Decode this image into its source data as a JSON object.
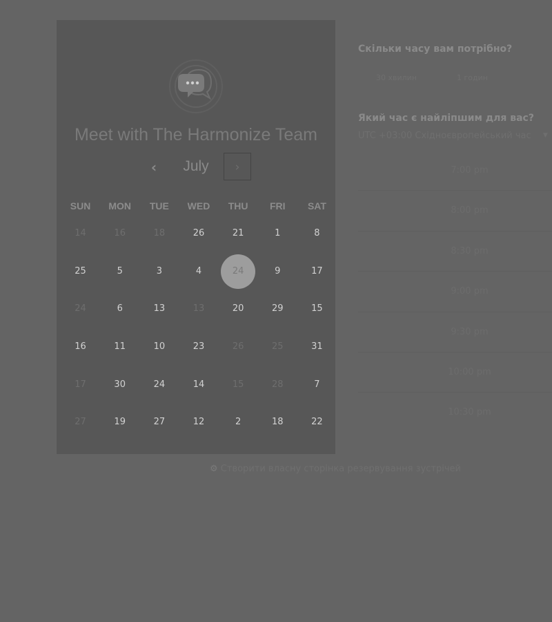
{
  "card": {
    "title": "Meet with The Harmonize Team",
    "month": "July",
    "prev_icon": "‹",
    "next_icon": "›",
    "weekdays": [
      "SUN",
      "MON",
      "TUE",
      "WED",
      "THU",
      "FRI",
      "SAT"
    ],
    "weeks": [
      [
        {
          "d": "14",
          "disabled": true
        },
        {
          "d": "16",
          "disabled": true
        },
        {
          "d": "18",
          "disabled": true
        },
        {
          "d": "26"
        },
        {
          "d": "21"
        },
        {
          "d": "1"
        },
        {
          "d": "8"
        }
      ],
      [
        {
          "d": "25"
        },
        {
          "d": "5"
        },
        {
          "d": "3"
        },
        {
          "d": "4"
        },
        {
          "d": "24",
          "selected": true
        },
        {
          "d": "9"
        },
        {
          "d": "17"
        }
      ],
      [
        {
          "d": "24",
          "disabled": true
        },
        {
          "d": "6"
        },
        {
          "d": "13"
        },
        {
          "d": "13",
          "disabled": true
        },
        {
          "d": "20"
        },
        {
          "d": "29"
        },
        {
          "d": "15"
        }
      ],
      [
        {
          "d": "16"
        },
        {
          "d": "11"
        },
        {
          "d": "10"
        },
        {
          "d": "23"
        },
        {
          "d": "26",
          "disabled": true
        },
        {
          "d": "25",
          "disabled": true
        },
        {
          "d": "31"
        }
      ],
      [
        {
          "d": "17",
          "disabled": true
        },
        {
          "d": "30"
        },
        {
          "d": "24"
        },
        {
          "d": "14"
        },
        {
          "d": "15",
          "disabled": true
        },
        {
          "d": "28",
          "disabled": true
        },
        {
          "d": "7"
        }
      ],
      [
        {
          "d": "27",
          "disabled": true
        },
        {
          "d": "19"
        },
        {
          "d": "27"
        },
        {
          "d": "12"
        },
        {
          "d": "2"
        },
        {
          "d": "18"
        },
        {
          "d": "22"
        }
      ]
    ]
  },
  "duration": {
    "question": "Скільки часу вам потрібно?",
    "options": [
      "30 хвилин",
      "1 годин"
    ]
  },
  "time": {
    "question": "Який час є найліпшим для вас?",
    "timezone": "UTC +03:00 Східноєвропейський час",
    "caret_icon": "▼",
    "slots": [
      "7:00 pm",
      "8:00 pm",
      "8:30 pm",
      "9:00 pm",
      "9:30 pm",
      "10:00 pm",
      "10:30 pm"
    ]
  },
  "footer": {
    "icon": "sprocket-icon",
    "link": "Створити власну сторінка резервування зустрічей"
  },
  "colors": {
    "overlay_bg": "#646464",
    "card_bg": "#575757",
    "selected_day": "#9d9d9d"
  }
}
